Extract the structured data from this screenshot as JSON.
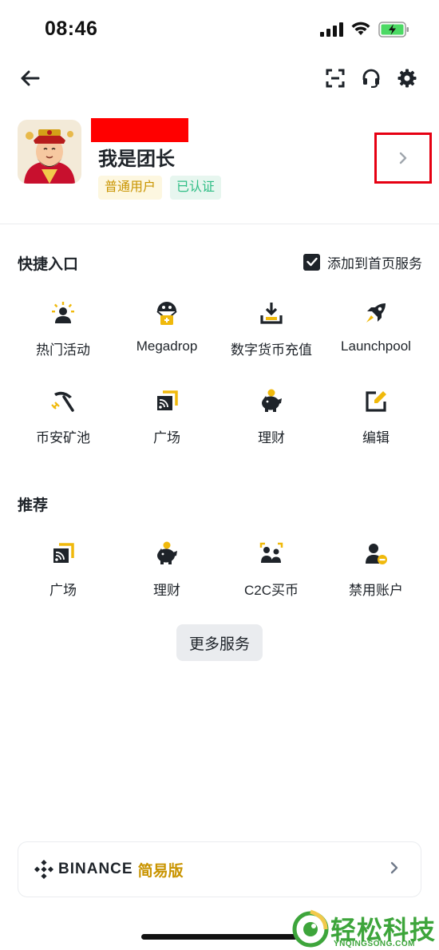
{
  "status_bar": {
    "time": "08:46"
  },
  "profile": {
    "username": "我是团长",
    "badges": [
      "普通用户",
      "已认证"
    ]
  },
  "quick_access": {
    "title": "快捷入口",
    "add_to_home_label": "添加到首页服务",
    "add_to_home_checked": true,
    "items": [
      {
        "label": "热门活动",
        "icon": "hot-activity-icon"
      },
      {
        "label": "Megadrop",
        "icon": "megadrop-icon"
      },
      {
        "label": "数字货币充值",
        "icon": "deposit-icon"
      },
      {
        "label": "Launchpool",
        "icon": "rocket-icon"
      },
      {
        "label": "币安矿池",
        "icon": "pickaxe-icon"
      },
      {
        "label": "广场",
        "icon": "square-feed-icon"
      },
      {
        "label": "理财",
        "icon": "piggy-bank-icon"
      },
      {
        "label": "编辑",
        "icon": "edit-icon"
      }
    ]
  },
  "recommended": {
    "title": "推荐",
    "items": [
      {
        "label": "广场",
        "icon": "square-feed-icon"
      },
      {
        "label": "理财",
        "icon": "piggy-bank-icon"
      },
      {
        "label": "C2C买币",
        "icon": "c2c-icon"
      },
      {
        "label": "禁用账户",
        "icon": "disable-account-icon"
      }
    ]
  },
  "more_services_label": "更多服务",
  "lite_card": {
    "brand": "BINANCE",
    "subtitle": "简易版"
  },
  "watermark": {
    "text": "轻松科技",
    "url": "YNQINGSONG.COM"
  },
  "colors": {
    "accent": "#f0b90b",
    "text": "#1e2329",
    "badge_yellow": "#c99400",
    "badge_green": "#2ebd85"
  }
}
